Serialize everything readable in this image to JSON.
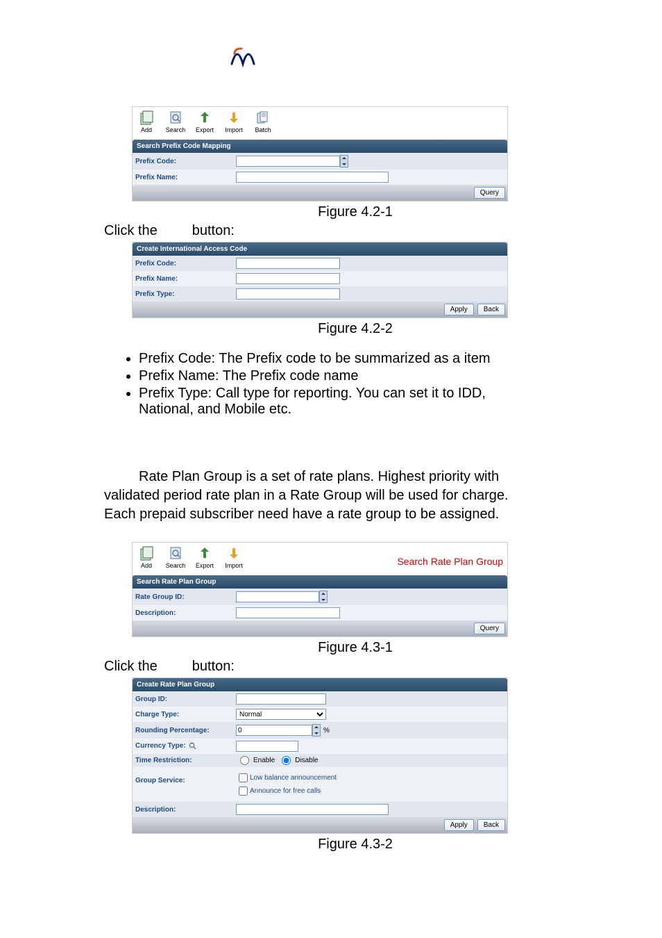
{
  "toolbar": {
    "add": "Add",
    "search": "Search",
    "export": "Export",
    "import": "Import",
    "batch": "Batch"
  },
  "section1": {
    "header": "Search Prefix Code Mapping",
    "prefix_code_label": "Prefix Code:",
    "prefix_name_label": "Prefix Name:",
    "query_btn": "Query",
    "caption": "Figure 4.2-1"
  },
  "click_text": "Click the",
  "button_text": "button:",
  "section2": {
    "header": "Create International Access Code",
    "prefix_code_label": "Prefix Code:",
    "prefix_name_label": "Prefix Name:",
    "prefix_type_label": "Prefix Type:",
    "apply_btn": "Apply",
    "back_btn": "Back",
    "caption": "Figure 4.2-2"
  },
  "bullets": {
    "b1": "Prefix Code: The Prefix code to be summarized as a item",
    "b2": "Prefix Name: The Prefix code name",
    "b3_line1": "Prefix Type: Call type for reporting. You can set it to IDD,",
    "b3_line2": "National, and Mobile etc."
  },
  "para2": {
    "l1": "Rate Plan Group is a set of rate plans. Highest priority with",
    "l2": "validated period rate plan in a Rate Group will be used for charge.",
    "l3": "Each prepaid subscriber need have a rate group to be assigned."
  },
  "section3": {
    "title_right": "Search Rate Plan Group",
    "header": "Search Rate Plan Group",
    "rate_group_id_label": "Rate Group ID:",
    "description_label": "Description:",
    "query_btn": "Query",
    "caption": "Figure 4.3-1"
  },
  "section4": {
    "header": "Create Rate Plan Group",
    "group_id_label": "Group ID:",
    "charge_type_label": "Charge Type:",
    "charge_type_value": "Normal",
    "rounding_label": "Rounding Percentage:",
    "rounding_value": "0",
    "rounding_unit": "%",
    "currency_label": "Currency Type:",
    "time_restriction_label": "Time Restriction:",
    "enable": "Enable",
    "disable": "Disable",
    "group_service_label": "Group Service:",
    "low_balance": "Low balance announcement",
    "announce_free": "Announce for free calls",
    "description_label": "Description:",
    "apply_btn": "Apply",
    "back_btn": "Back",
    "caption": "Figure 4.3-2"
  }
}
